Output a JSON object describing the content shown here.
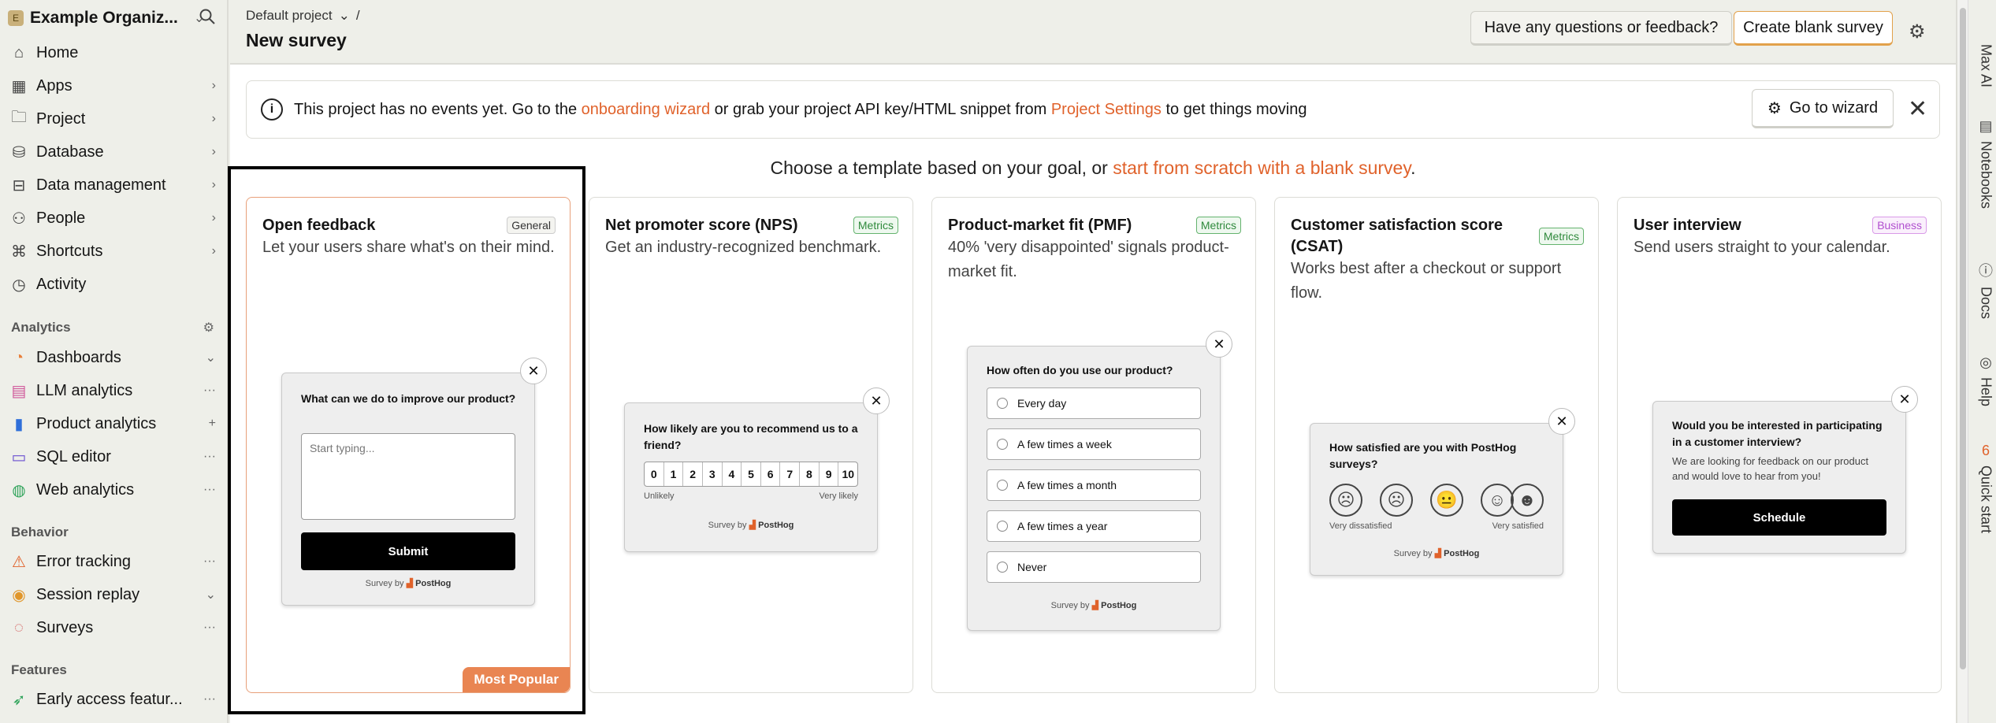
{
  "org": {
    "name": "Example Organiz...",
    "logo_letter": "E"
  },
  "sidebar": {
    "nav": [
      {
        "label": "Home",
        "icon": "home-icon"
      },
      {
        "label": "Apps",
        "icon": "apps-icon"
      },
      {
        "label": "Project",
        "icon": "folder-icon"
      },
      {
        "label": "Database",
        "icon": "database-icon"
      },
      {
        "label": "Data management",
        "icon": "data-management-icon"
      },
      {
        "label": "People",
        "icon": "people-icon"
      },
      {
        "label": "Shortcuts",
        "icon": "shortcuts-icon"
      },
      {
        "label": "Activity",
        "icon": "clock-icon"
      }
    ],
    "analytics_title": "Analytics",
    "analytics": [
      {
        "label": "Dashboards",
        "icon": "dashboards-icon"
      },
      {
        "label": "LLM analytics",
        "icon": "llm-analytics-icon"
      },
      {
        "label": "Product analytics",
        "icon": "product-analytics-icon"
      },
      {
        "label": "SQL editor",
        "icon": "sql-editor-icon"
      },
      {
        "label": "Web analytics",
        "icon": "web-analytics-icon"
      }
    ],
    "behavior_title": "Behavior",
    "behavior": [
      {
        "label": "Error tracking",
        "icon": "warning-icon"
      },
      {
        "label": "Session replay",
        "icon": "session-replay-icon"
      },
      {
        "label": "Surveys",
        "icon": "surveys-icon"
      }
    ],
    "features_title": "Features",
    "features": [
      {
        "label": "Early access featur...",
        "icon": "rocket-icon"
      }
    ]
  },
  "header": {
    "breadcrumb": "Default project",
    "breadcrumb_sep": "/",
    "title": "New survey",
    "feedback_label": "Have any questions or feedback?",
    "create_label": "Create blank survey"
  },
  "banner": {
    "text_1": "This project has no events yet. Go to the ",
    "link_1": "onboarding wizard",
    "text_2": " or grab your project API key/HTML snippet from ",
    "link_2": "Project Settings",
    "text_3": " to get things moving",
    "button": "Go to wizard"
  },
  "choose": {
    "text": "Choose a template based on your goal, or ",
    "link": "start from scratch with a blank survey",
    "end": "."
  },
  "cards": [
    {
      "title": "Open feedback",
      "tag": "General",
      "desc": "Let your users share what's on their mind.",
      "badge": "Most Popular",
      "preview": {
        "question": "What can we do to improve our product?",
        "placeholder": "Start typing...",
        "button": "Submit"
      }
    },
    {
      "title": "Net promoter score (NPS)",
      "tag": "Metrics",
      "desc": "Get an industry-recognized benchmark.",
      "preview": {
        "question": "How likely are you to recommend us to a friend?",
        "scale": [
          "0",
          "1",
          "2",
          "3",
          "4",
          "5",
          "6",
          "7",
          "8",
          "9",
          "10"
        ],
        "low": "Unlikely",
        "high": "Very likely"
      }
    },
    {
      "title": "Product-market fit (PMF)",
      "tag": "Metrics",
      "desc": "40% 'very disappointed' signals product-market fit.",
      "preview": {
        "question": "How often do you use our product?",
        "choices": [
          "Every day",
          "A few times a week",
          "A few times a month",
          "A few times a year",
          "Never"
        ]
      }
    },
    {
      "title": "Customer satisfaction score (CSAT)",
      "tag": "Metrics",
      "desc": "Works best after a checkout or support flow.",
      "preview": {
        "question": "How satisfied are you with PostHog surveys?",
        "low": "Very dissatisfied",
        "high": "Very satisfied"
      }
    },
    {
      "title": "User interview",
      "tag": "Business",
      "desc": "Send users straight to your calendar.",
      "preview": {
        "question": "Would you be interested in participating in a customer interview?",
        "description": "We are looking for feedback on our product and would love to hear from you!",
        "button": "Schedule"
      }
    }
  ],
  "survey_by": "Survey by",
  "posthog": "PostHog",
  "rail": [
    "Max AI",
    "Notebooks",
    "Docs",
    "Help",
    "Quick start"
  ],
  "rail_badge": "6",
  "colors": {
    "accent": "#e0622b",
    "metrics": "#2f8a3c",
    "business": "#b14fcf"
  }
}
